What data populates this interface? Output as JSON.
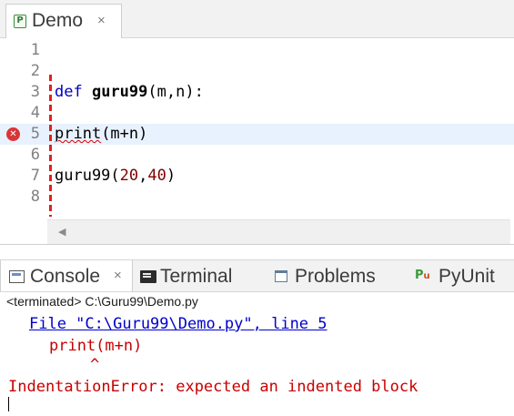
{
  "editor_tab": {
    "title": "Demo",
    "close": "×",
    "icon": "P"
  },
  "editor": {
    "lines": [
      {
        "num": "1"
      },
      {
        "num": "2"
      },
      {
        "num": "3",
        "kw": "def",
        "fn": "guru99",
        "rest": "(m,n):"
      },
      {
        "num": "4"
      },
      {
        "num": "5",
        "err_word": "print",
        "rest": "(m+n)",
        "error_icon": "error-x-icon"
      },
      {
        "num": "6"
      },
      {
        "num": "7",
        "call": "guru99(",
        "arg1": "20",
        "comma": ",",
        "arg2": "40",
        "close": ")"
      },
      {
        "num": "8"
      }
    ],
    "scroll_arrow": "◀"
  },
  "console_tabs": [
    {
      "label": "Console",
      "close": "×",
      "active": true
    },
    {
      "label": "Terminal"
    },
    {
      "label": "Problems"
    },
    {
      "label": "PyUnit",
      "icon_text": "P",
      "icon_sub": "u"
    }
  ],
  "console": {
    "status": "<terminated> C:\\Guru99\\Demo.py",
    "file_line": "File \"C:\\Guru99\\Demo.py\", line 5",
    "code_line": "print(m+n)",
    "caret": "^",
    "error_line": "IndentationError: expected an indented block"
  },
  "colors": {
    "keyword": "#0000c0",
    "number": "#800000",
    "error": "#c80000",
    "link": "#0000cc",
    "current_line": "#e8f2fe"
  }
}
